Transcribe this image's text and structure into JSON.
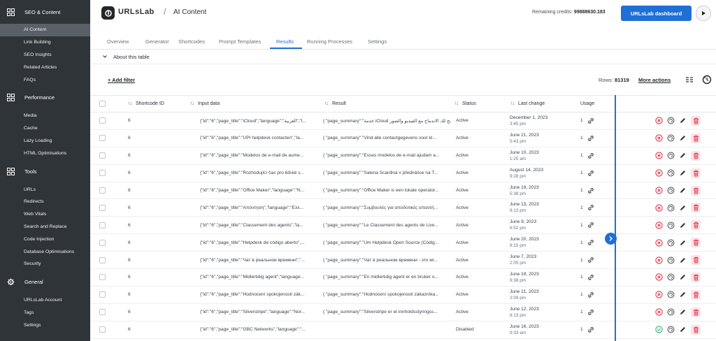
{
  "sidebar": {
    "sections": [
      {
        "title": "SEO & Content",
        "icon": "grid-icon",
        "items": [
          "AI Content",
          "Link Building",
          "SEO Insights",
          "Related Articles",
          "FAQs"
        ]
      },
      {
        "title": "Performance",
        "icon": "grid-icon",
        "items": [
          "Media",
          "Cache",
          "Lazy Loading",
          "HTML Optimisations"
        ]
      },
      {
        "title": "Tools",
        "icon": "grid-icon",
        "items": [
          "URLs",
          "Redirects",
          "Web Vitals",
          "Search and Replace",
          "Code Injection",
          "Database Optimisations",
          "Security"
        ]
      },
      {
        "title": "General",
        "icon": "gear-icon",
        "items": [
          "URLsLab Account",
          "Tags",
          "Settings"
        ]
      }
    ],
    "active_item": "AI Content"
  },
  "header": {
    "logo_text": "URLsLab",
    "slash": "/",
    "title": "AI Content",
    "credits_label": "Remaining credits:",
    "credits_value": "99888630.183",
    "dashboard_button": "URLsLab dashboard"
  },
  "tabs": [
    "Overview",
    "Generator",
    "Shortcodes",
    "Prompt Templates",
    "Results",
    "Running Processes",
    "Settings"
  ],
  "active_tab": "Results",
  "about_label": "About this table",
  "toolbar": {
    "add_filter": "+ Add filter",
    "rows_label": "Rows:",
    "rows_value": "81319",
    "more_actions": "More actions"
  },
  "table": {
    "columns": [
      "Shortcode ID",
      "Input data",
      "Result",
      "Status",
      "Last change",
      "Usage"
    ],
    "rows": [
      {
        "id": "6",
        "input": "{\"id\":\"6\",\"page_title\":\"iCloud\",\"language\":\"العربية\",\"l...",
        "result": "{ \"page_summary\":\"خدمة iCloud تتيح لك الاندماج مع الفيديو والصور...",
        "status": "Active",
        "date": "December 1, 2023",
        "time": "3:45 pm",
        "usage": "1"
      },
      {
        "id": "6",
        "input": "{\"id\":\"6\",\"page_title\":\"UPI helpdesk contacten\",\"la...",
        "result": "{ \"page_summary\":\"Vind alle contactgegevens voor kl...",
        "status": "Active",
        "date": "June 21, 2023",
        "time": "5:43 pm",
        "usage": "1"
      },
      {
        "id": "6",
        "input": "{\"id\":\"6\",\"page_title\":\"Modelos de e-mail de aume...",
        "result": "{ \"page_summary\":\"Esses modelos de e-mail ajudam a...",
        "status": "Active",
        "date": "June 10, 2023",
        "time": "1:25 am",
        "usage": "1"
      },
      {
        "id": "6",
        "input": "{\"id\":\"6\",\"page_title\":\"Rozhodující čas pro lidské s...",
        "result": "{ \"page_summary\":\"Salena Scardina v přednášce na T...",
        "status": "Active",
        "date": "August 14, 2023",
        "time": "9:28 pm",
        "usage": "1"
      },
      {
        "id": "6",
        "input": "{\"id\":\"6\",\"page_title\":\"Office Maker\",\"language\":\"N...",
        "result": "{ \"page_summary\":\"Office Maker is een lokale operator...",
        "status": "Active",
        "date": "June 19, 2023",
        "time": "5:38 pm",
        "usage": "1"
      },
      {
        "id": "6",
        "input": "{\"id\":\"6\",\"page_title\":\"Απόντηση\",\"language\":\"Ελλ...",
        "result": "{ \"page_summary\":\"Συμβουλές για αποδοτικές απαντή...",
        "status": "Active",
        "date": "June 13, 2023",
        "time": "8:13 pm",
        "usage": "1"
      },
      {
        "id": "6",
        "input": "{\"id\":\"6\",\"page_title\":\"Classement des agents\",\"la...",
        "result": "{ \"page_summary\":\"Le Classement des agents de Live...",
        "status": "Active",
        "date": "June 9, 2023",
        "time": "6:52 pm",
        "usage": "1"
      },
      {
        "id": "6",
        "input": "{\"id\":\"6\",\"page_title\":\"Helpdesk de código aberto\",...",
        "result": "{ \"page_summary\":\"Um Helpdesk Open Source (Códig...",
        "status": "Active",
        "date": "June 20, 2023",
        "time": "8:15 pm",
        "usage": "1"
      },
      {
        "id": "6",
        "input": "{\"id\":\"6\",\"page_title\":\"Чат в реальном времени\",\"...",
        "result": "{ \"page_summary\":\"Чат в реальном времени - это мг...",
        "status": "Active",
        "date": "June 7, 2023",
        "time": "2:05 pm",
        "usage": "1"
      },
      {
        "id": "6",
        "input": "{\"id\":\"6\",\"page_title\":\"Midlertidig agent\",\"language...",
        "result": "{ \"page_summary\":\"En midlertidig agent er en bruker o...",
        "status": "Active",
        "date": "June 19, 2023",
        "time": "9:38 pm",
        "usage": "1"
      },
      {
        "id": "6",
        "input": "{\"id\":\"6\",\"page_title\":\"Hodnocení spokojenosti zák...",
        "result": "{ \"page_summary\":\"Hodnocení spokojenosti zákazníka...",
        "status": "Active",
        "date": "June 21, 2023",
        "time": "2:09 pm",
        "usage": "1"
      },
      {
        "id": "6",
        "input": "{\"id\":\"6\",\"page_title\":\"Silverstripe\",\"language\":\"Nor...",
        "result": "{ \"page_summary\":\"Silverstripe er et innholdsstyringss...",
        "status": "Active",
        "date": "June 12, 2023",
        "time": "8:13 pm",
        "usage": "1"
      },
      {
        "id": "6",
        "input": "{\"id\":\"6\",\"page_title\":\"GBC Networks\",\"language\":\"...",
        "result": "",
        "status": "Disabled",
        "date": "June 16, 2023",
        "time": "9:33 am",
        "usage": "1"
      }
    ]
  },
  "colors": {
    "sidebar_bg": "#2f3439",
    "sidebar_active": "#5a6068",
    "accent": "#1f6fd6",
    "danger": "#e0344b",
    "success": "#2fb36b"
  }
}
